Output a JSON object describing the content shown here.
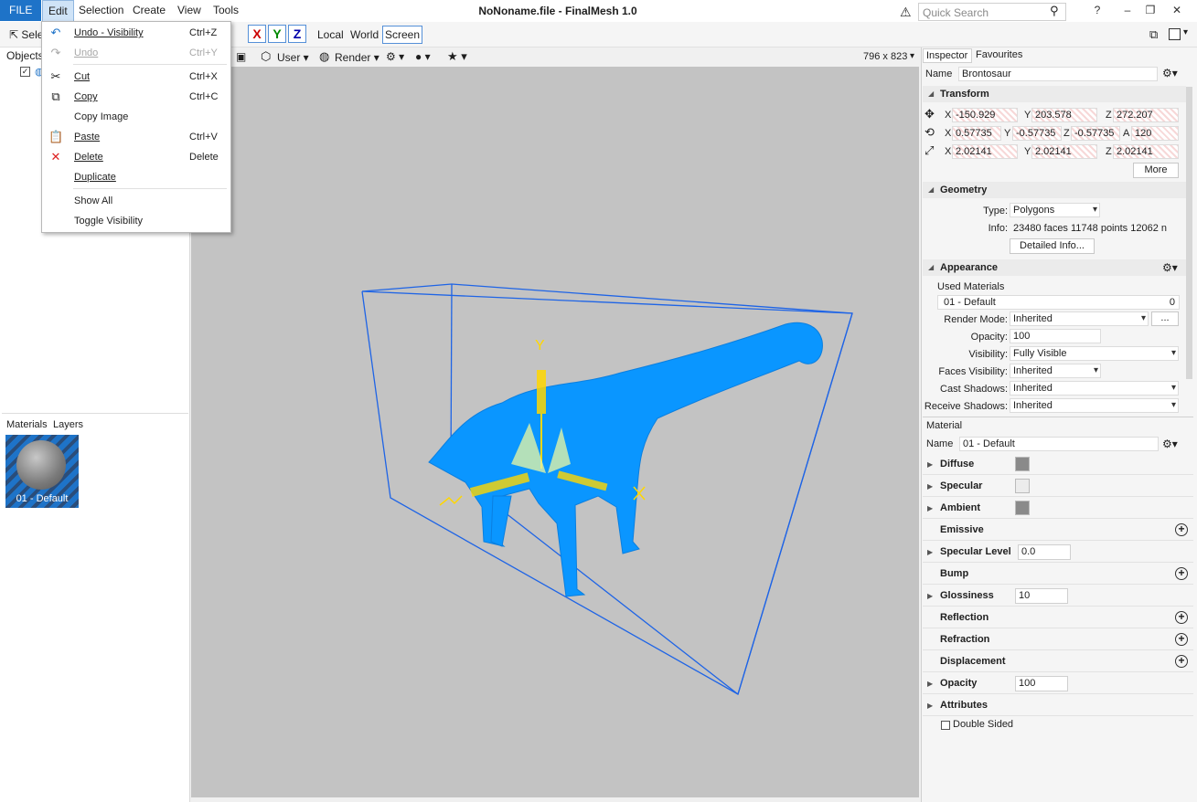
{
  "menubar": {
    "items": [
      "FILE",
      "Edit",
      "Selection",
      "Create",
      "View",
      "Tools"
    ]
  },
  "title": "NoNoname.file - FinalMesh 1.0",
  "search": {
    "placeholder": "Quick Search"
  },
  "window": {
    "help": "?",
    "minimize": "–",
    "restore": "❐",
    "close": "✕"
  },
  "toolbar": {
    "select": "Sele",
    "x": "X",
    "y": "Y",
    "z": "Z",
    "local": "Local",
    "world": "World",
    "screen": "Screen"
  },
  "leftpanel": {
    "objects_tab": "Objects",
    "materials_tab": "Materials",
    "layers_tab": "Layers",
    "material_thumb": "01 - Default"
  },
  "viewport_toolbar": {
    "user": "User",
    "render": "Render",
    "size": "796 x 823"
  },
  "edit_menu": [
    {
      "label": "Undo - Visibility",
      "shortcut": "Ctrl+Z",
      "icon": "undo-icon",
      "disabled": false
    },
    {
      "label": "Undo",
      "shortcut": "Ctrl+Y",
      "icon": "redo-icon",
      "disabled": true
    },
    {
      "label": "Cut",
      "shortcut": "Ctrl+X",
      "icon": "cut-icon",
      "disabled": false
    },
    {
      "label": "Copy",
      "shortcut": "Ctrl+C",
      "icon": "copy-icon",
      "disabled": false
    },
    {
      "label": "Copy Image",
      "shortcut": "",
      "icon": "",
      "disabled": false
    },
    {
      "label": "Paste",
      "shortcut": "Ctrl+V",
      "icon": "paste-icon",
      "disabled": false
    },
    {
      "label": "Delete",
      "shortcut": "Delete",
      "icon": "delete-icon",
      "disabled": false
    },
    {
      "label": "Duplicate",
      "shortcut": "",
      "icon": "",
      "disabled": false
    },
    {
      "label": "Show All",
      "shortcut": "",
      "icon": "",
      "disabled": false
    },
    {
      "label": "Toggle Visibility",
      "shortcut": "",
      "icon": "",
      "disabled": false
    }
  ],
  "inspector": {
    "tabs": [
      "Inspector",
      "Favourites"
    ],
    "name_label": "Name",
    "name_value": "Brontosaur",
    "transform": {
      "title": "Transform",
      "pos": {
        "x": "-150.929",
        "y": "203.578",
        "z": "272.207"
      },
      "rot": {
        "x": "0.57735",
        "y": "-0.57735",
        "z": "-0.57735",
        "a": "120"
      },
      "scale": {
        "x": "2.02141",
        "y": "2.02141",
        "z": "2.02141"
      },
      "more": "More"
    },
    "geometry": {
      "title": "Geometry",
      "type_label": "Type:",
      "type_value": "Polygons",
      "info_label": "Info:",
      "info_value": "23480 faces 11748 points 12062 n",
      "detail_btn": "Detailed Info..."
    },
    "appearance": {
      "title": "Appearance",
      "used_materials": "Used Materials",
      "material_item": "01 - Default",
      "material_count": "0",
      "render_mode_label": "Render Mode:",
      "render_mode": "Inherited",
      "opacity_label": "Opacity:",
      "opacity": "100",
      "visibility_label": "Visibility:",
      "visibility": "Fully Visible",
      "faces_vis_label": "Faces Visibility:",
      "faces_vis": "Inherited",
      "cast_label": "Cast Shadows:",
      "cast": "Inherited",
      "receive_label": "Receive Shadows:",
      "receive": "Inherited"
    }
  },
  "material": {
    "header": "Material",
    "name_label": "Name",
    "name_value": "01 - Default",
    "rows": [
      "Diffuse",
      "Specular",
      "Ambient",
      "Emissive",
      "Specular Level",
      "Bump",
      "Glossiness",
      "Reflection",
      "Refraction",
      "Displacement",
      "Opacity",
      "Attributes"
    ],
    "spec_level": "0.0",
    "glossiness": "10",
    "opacity": "100",
    "double_sided": "Double Sided"
  },
  "colors": {
    "mesh": "#0a96ff",
    "bbox": "#1e64e6",
    "gizmo": "#ffd700"
  }
}
